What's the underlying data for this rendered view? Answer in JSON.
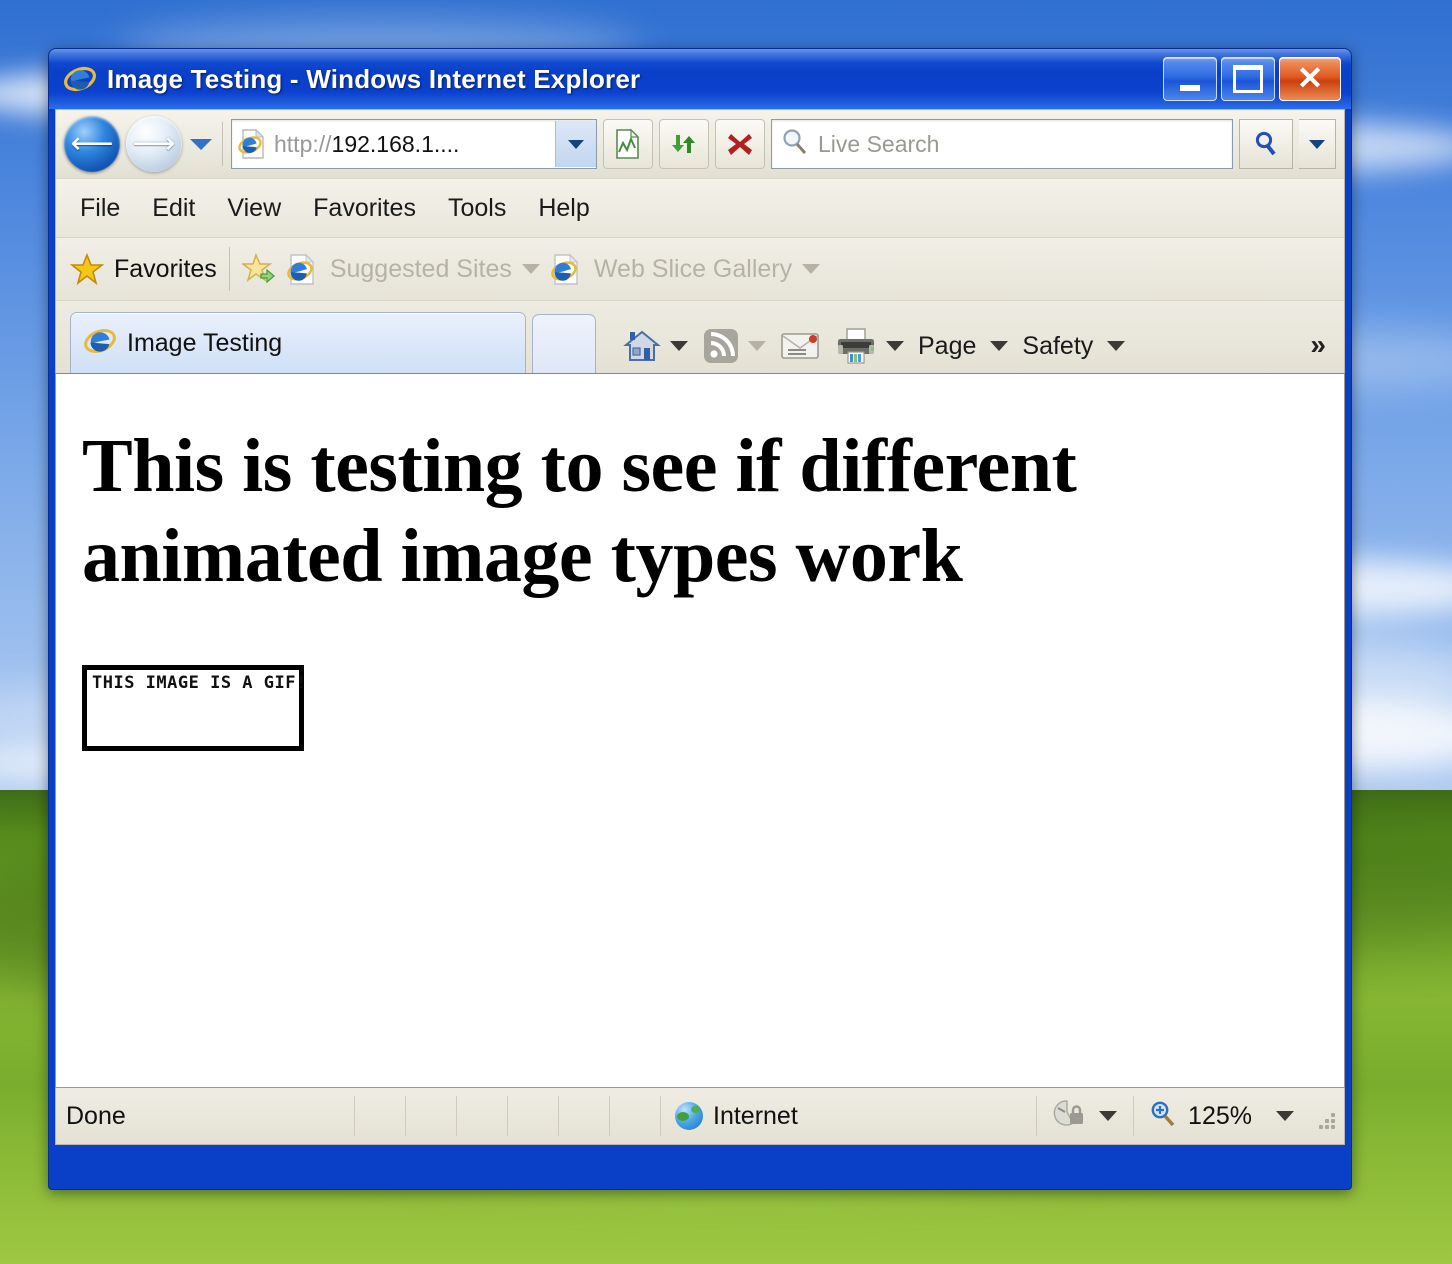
{
  "window": {
    "title": "Image Testing - Windows Internet Explorer",
    "minimize_label": "Minimize",
    "maximize_label": "Maximize",
    "close_label": "Close"
  },
  "toolbar": {
    "back_label": "Back",
    "forward_label": "Forward",
    "recent_pages_label": "Recent Pages",
    "address_value": "http://192.168.1....",
    "address_scheme": "http://",
    "address_host": "192.168.1....",
    "compat_view_label": "Compatibility View",
    "refresh_label": "Refresh",
    "stop_label": "Stop",
    "search_placeholder": "Live Search",
    "search_go_label": "Search",
    "search_options_label": "Search Options"
  },
  "menu": {
    "items": [
      {
        "label": "File"
      },
      {
        "label": "Edit"
      },
      {
        "label": "View"
      },
      {
        "label": "Favorites"
      },
      {
        "label": "Tools"
      },
      {
        "label": "Help"
      }
    ]
  },
  "favorites_bar": {
    "favorites_label": "Favorites",
    "add_label": "Add to Favorites Bar",
    "items": [
      {
        "label": "Suggested Sites"
      },
      {
        "label": "Web Slice Gallery"
      }
    ]
  },
  "tabs": {
    "items": [
      {
        "label": "Image Testing"
      }
    ],
    "new_tab_label": "New Tab"
  },
  "command_bar": {
    "home_label": "Home",
    "feeds_label": "Feeds",
    "mail_label": "Read Mail",
    "print_label": "Print",
    "page_label": "Page",
    "safety_label": "Safety",
    "overflow_label": "»"
  },
  "page": {
    "heading": "This is testing to see if different animated image types work",
    "image": {
      "alt_text": "THIS IMAGE IS A GIF!",
      "caption": "THIS IMAGE IS A GIF!"
    }
  },
  "status_bar": {
    "status_text": "Done",
    "zone_label": "Internet",
    "protected_mode_label": "Protected Mode",
    "zoom_label": "125%",
    "resize_grip_label": "Resize"
  },
  "colors": {
    "title_bar": "#0a3fc8",
    "chrome": "#e9e7db",
    "close_button": "#e05a20",
    "accent": "#1d6fc0",
    "desktop_sky": "#4b85dd",
    "desktop_grass": "#86b633"
  }
}
